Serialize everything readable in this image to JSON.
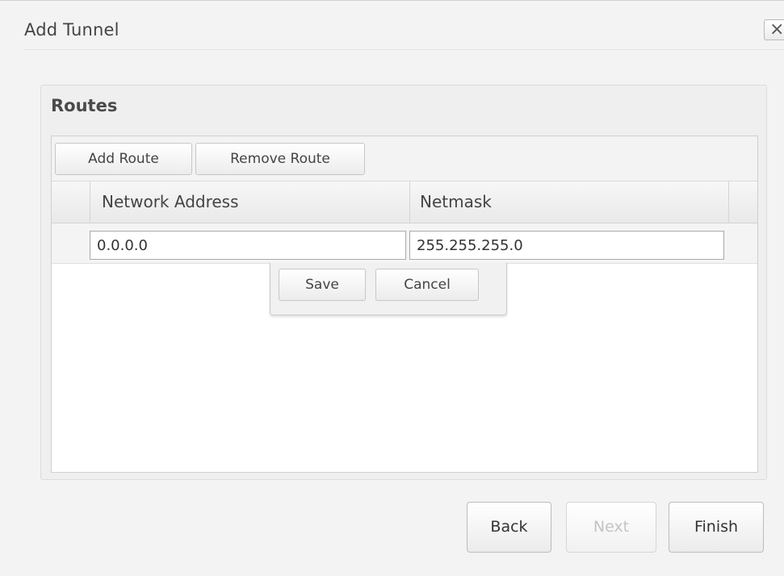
{
  "dialog": {
    "title": "Add Tunnel",
    "close_glyph": "×"
  },
  "section": {
    "title": "Routes"
  },
  "toolbar": {
    "add_route_label": "Add Route",
    "remove_route_label": "Remove Route"
  },
  "table": {
    "columns": [
      "Network Address",
      "Netmask"
    ],
    "rows": [
      {
        "network_address": "0.0.0.0",
        "netmask": "255.255.255.0"
      }
    ]
  },
  "row_editor": {
    "save_label": "Save",
    "cancel_label": "Cancel"
  },
  "footer": {
    "back_label": "Back",
    "next_label": "Next",
    "finish_label": "Finish",
    "next_disabled": true
  },
  "icons": {
    "close": "close-icon"
  },
  "colors": {
    "dialog_bg": "#f3f3f3",
    "grid_bg": "#ffffff",
    "disabled_text": "#c4c4c4"
  }
}
